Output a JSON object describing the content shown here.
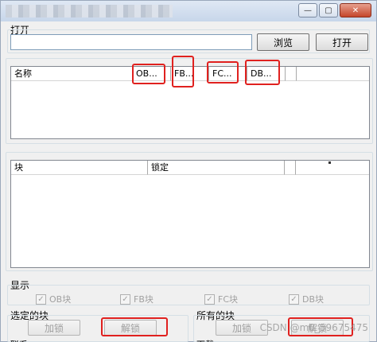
{
  "window": {
    "controls": {
      "minimize": "—",
      "maximize": "▢",
      "close": "✕"
    }
  },
  "open_section": {
    "label": "打开",
    "path_value": "",
    "browse_label": "浏览",
    "open_label": "打开"
  },
  "blocks_table": {
    "headers": [
      "名称",
      "OB...",
      "FB...",
      "FC...",
      "DB..."
    ]
  },
  "lock_table": {
    "headers": [
      "块",
      "锁定"
    ]
  },
  "display": {
    "label": "显示",
    "checkboxes": [
      {
        "label": "OB块",
        "checked": true
      },
      {
        "label": "FB块",
        "checked": true
      },
      {
        "label": "FC块",
        "checked": true
      },
      {
        "label": "DB块",
        "checked": true
      }
    ]
  },
  "selected_blocks": {
    "label": "选定的块",
    "lock_label": "加锁",
    "unlock_label": "解锁"
  },
  "all_blocks": {
    "label": "所有的块",
    "lock_label": "加锁",
    "unlock_label": "解锁"
  },
  "bottom": {
    "left_label": "联系",
    "right_label": "下载"
  },
  "watermark": "CSDN @m0_59675475",
  "colors": {
    "highlight": "#e0211f",
    "window_bg": "#f0f0f0"
  }
}
